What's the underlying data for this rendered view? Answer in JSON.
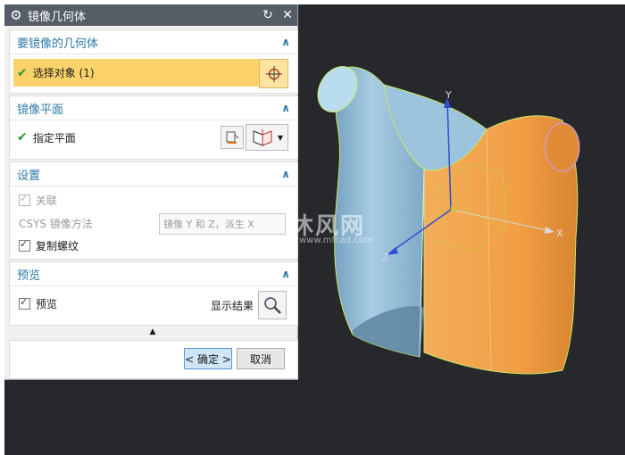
{
  "dialog": {
    "title": "镜像几何体",
    "sections": {
      "geometry": {
        "header": "要镜像的几何体",
        "select_label": "选择对象 (1)"
      },
      "plane": {
        "header": "镜像平面",
        "specify_label": "指定平面"
      },
      "settings": {
        "header": "设置",
        "associate_label": "关联",
        "associate_checked": true,
        "csys_label": "CSYS 镜像方法",
        "csys_value": "镜像 Y 和 Z，派生 X",
        "copy_thread_label": "复制螺纹",
        "copy_thread_checked": true
      },
      "preview": {
        "header": "预览",
        "preview_label": "预览",
        "preview_checked": true,
        "show_result_label": "显示结果"
      }
    },
    "buttons": {
      "ok": "< 确定 >",
      "cancel": "取消"
    },
    "colors": {
      "titlebar": "#555d66",
      "section_header": "#2e78a8",
      "selection_highlight": "#fcd36a"
    }
  },
  "viewport": {
    "background": "#27282b",
    "axes": {
      "x": "X",
      "y": "Y",
      "z": "Z"
    },
    "watermark": {
      "main": "沐风网",
      "sub": "www.mfcad.com"
    },
    "colors": {
      "original_body": "#f0a04a",
      "mirror_body": "#8fb7d2",
      "edge": "#c9e96b"
    }
  }
}
